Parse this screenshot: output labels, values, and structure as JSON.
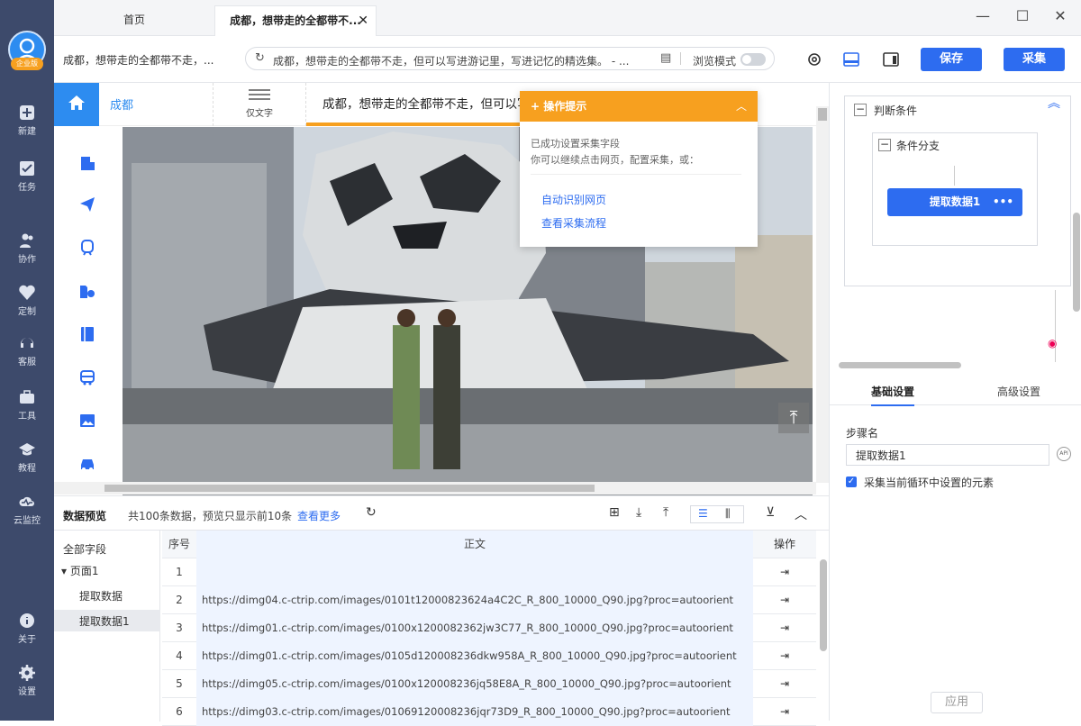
{
  "sidebar": {
    "badge": "企业版",
    "items": [
      {
        "label": "新建",
        "icon": "plus-square-icon"
      },
      {
        "label": "任务",
        "icon": "flag-icon"
      },
      {
        "label": "协作",
        "icon": "users-icon"
      },
      {
        "label": "定制",
        "icon": "heart-icon"
      },
      {
        "label": "客服",
        "icon": "headset-icon"
      },
      {
        "label": "工具",
        "icon": "toolbox-icon"
      },
      {
        "label": "教程",
        "icon": "graduation-icon"
      },
      {
        "label": "云监控",
        "icon": "cloud-monitor-icon"
      }
    ],
    "bottom_items": [
      {
        "label": "关于",
        "icon": "info-icon"
      },
      {
        "label": "设置",
        "icon": "gear-icon"
      }
    ]
  },
  "tabs": {
    "home": "首页",
    "active": "成都，想带走的全都带不..."
  },
  "toolbar": {
    "page_title": "成都，想带走的全都带不走，...",
    "address": "成都，想带走的全都带不走，但可以写进游记里，写进记忆的精选集。 - ...",
    "browse_mode": "浏览模式",
    "save_label": "保存",
    "collect_label": "采集"
  },
  "browser": {
    "city": "成都",
    "text_only": "仅文字",
    "headline": "成都，想带走的全都带不走，但可以写进游记"
  },
  "tip": {
    "title": "操作提示",
    "line1": "已成功设置采集字段",
    "line2": "你可以继续点击网页，配置采集，或：",
    "link1": "自动识别网页",
    "link2": "查看采集流程"
  },
  "preview": {
    "title": "数据预览",
    "summary": "共100条数据，预览只显示前10条",
    "more": "查看更多",
    "fields_title": "全部字段",
    "page": "页面1",
    "field1": "提取数据",
    "field2": "提取数据1",
    "col_no": "序号",
    "col_body": "正文",
    "col_op": "操作",
    "rows": [
      {
        "no": "1",
        "body": ""
      },
      {
        "no": "2",
        "body": "https://dimg04.c-ctrip.com/images/0101t12000823624a4C2C_R_800_10000_Q90.jpg?proc=autoorient"
      },
      {
        "no": "3",
        "body": "https://dimg01.c-ctrip.com/images/0100x1200082362jw3C77_R_800_10000_Q90.jpg?proc=autoorient"
      },
      {
        "no": "4",
        "body": "https://dimg01.c-ctrip.com/images/0105d120008236dkw958A_R_800_10000_Q90.jpg?proc=autoorient"
      },
      {
        "no": "5",
        "body": "https://dimg05.c-ctrip.com/images/0100x120008236jq58E8A_R_800_10000_Q90.jpg?proc=autoorient"
      },
      {
        "no": "6",
        "body": "https://dimg03.c-ctrip.com/images/01069120008236jqr73D9_R_800_10000_Q90.jpg?proc=autoorient"
      }
    ]
  },
  "flow": {
    "condition": "判断条件",
    "branch": "条件分支",
    "extract": "提取数据1"
  },
  "settings": {
    "tab_basic": "基础设置",
    "tab_advanced": "高级设置",
    "step_label": "步骤名",
    "step_value": "提取数据1",
    "checkbox_label": "采集当前循环中设置的元素",
    "apply": "应用"
  }
}
